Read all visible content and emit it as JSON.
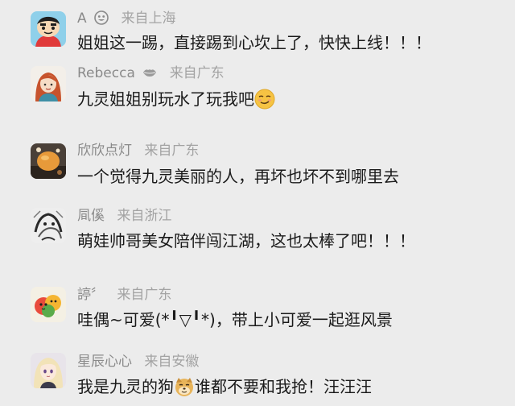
{
  "comments": [
    {
      "username": "A",
      "location": "来自上海",
      "text": "姐姐这一踢，直接踢到心坎上了，快快上线！！！",
      "avatar_icon": "crayon-shinchan-avatar",
      "badge_icon": "ghost-badge-icon"
    },
    {
      "username": "Rebecca",
      "location": "来自广东",
      "text": "九灵姐姐别玩水了玩我吧",
      "avatar_icon": "red-hair-girl-avatar",
      "badge_icon": "kiss-lips-icon",
      "emoji": "smug-face-emoji"
    },
    {
      "username": "欣欣点灯",
      "location": "来自广东",
      "text": "一个觉得九灵美丽的人，再坏也坏不到哪里去",
      "avatar_icon": "food-photo-avatar"
    },
    {
      "username": "凬傒",
      "location": "来自浙江",
      "text": "萌娃帅哥美女陪伴闯江湖，这也太棒了吧！！！",
      "avatar_icon": "ink-sketch-avatar"
    },
    {
      "username": "諪〞",
      "location": "来自广东",
      "text": "哇偶~可爱(*╹▽╹*)，带上小可爱一起逛风景",
      "avatar_icon": "colorful-cartoon-avatar"
    },
    {
      "username": "星辰心心",
      "location": "来自安徽",
      "text_before": "我是九灵的狗",
      "text_after": "谁都不要和我抢！汪汪汪",
      "avatar_icon": "anime-girl-avatar",
      "emoji": "doge-emoji"
    }
  ]
}
